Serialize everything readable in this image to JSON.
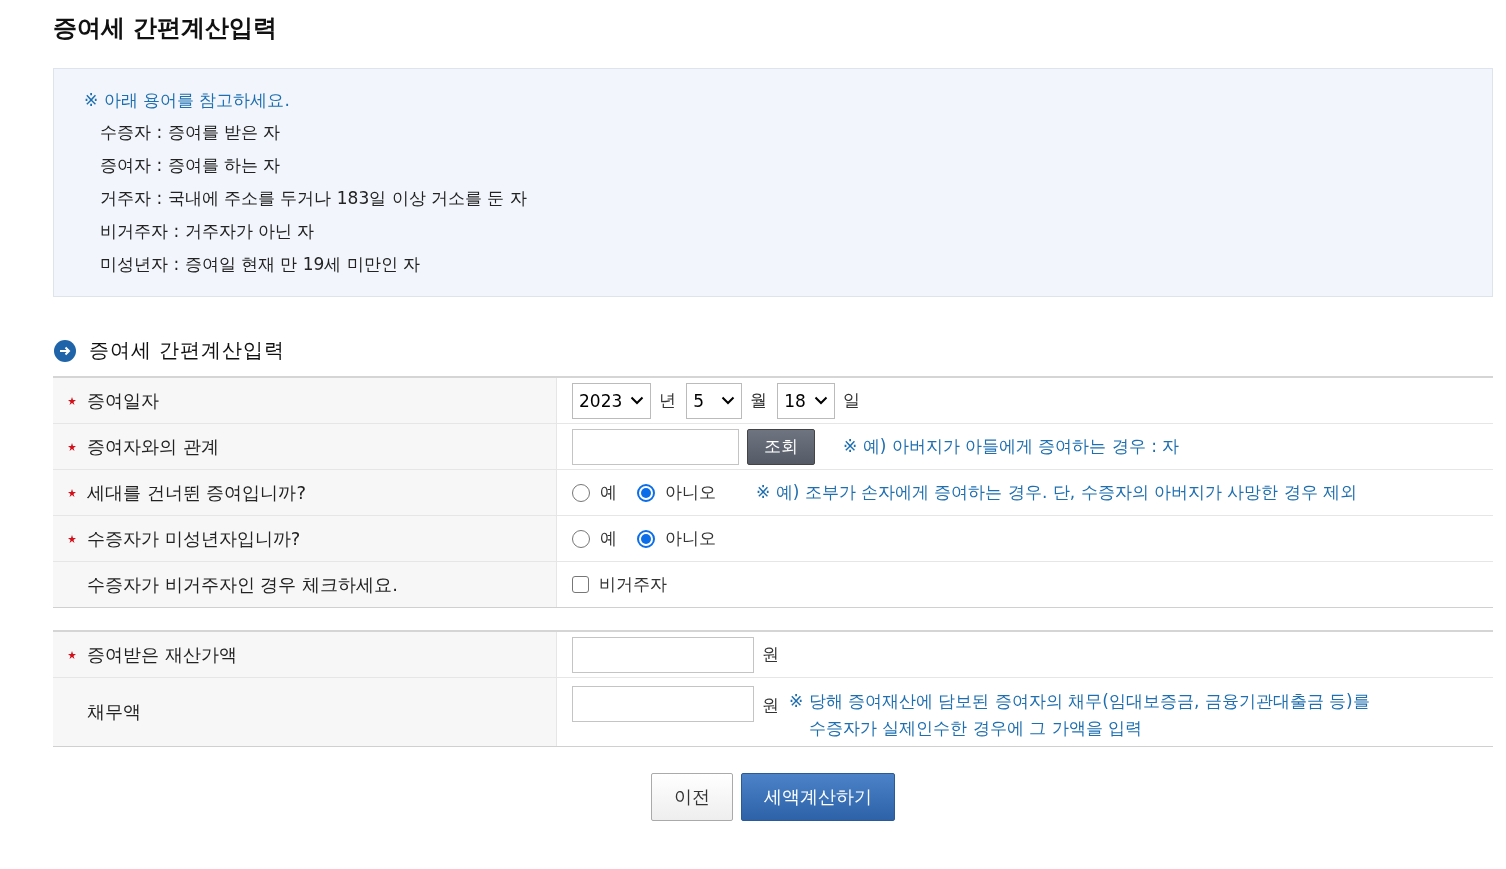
{
  "page_title": "증여세 간편계산입력",
  "terms_box": {
    "heading": "※ 아래 용어를 참고하세요.",
    "items": [
      "수증자 : 증여를 받은 자",
      "증여자 : 증여를 하는 자",
      "거주자 : 국내에 주소를 두거나 183일 이상 거소를 둔 자",
      "비거주자 : 거주자가 아닌 자",
      "미성년자 : 증여일 현재 만 19세 미만인 자"
    ]
  },
  "section_title": "증여세 간편계산입력",
  "form_groups": [
    {
      "rows": [
        {
          "kind": "date",
          "label": "증여일자",
          "required": true,
          "fields": [
            {
              "value": "2023",
              "unit": "년"
            },
            {
              "value": "5",
              "unit": "월"
            },
            {
              "value": "18",
              "unit": "일"
            }
          ]
        },
        {
          "kind": "lookup",
          "label": "증여자와의 관계",
          "required": true,
          "button": "조회",
          "note": "※ 예) 아버지가 아들에게 증여하는 경우 : 자"
        },
        {
          "kind": "radio",
          "label": "세대를 건너뛴 증여입니까?",
          "required": true,
          "options": [
            {
              "label": "예",
              "selected": false
            },
            {
              "label": "아니오",
              "selected": true
            }
          ],
          "note": "※ 예) 조부가 손자에게 증여하는 경우. 단, 수증자의 아버지가 사망한 경우 제외"
        },
        {
          "kind": "radio",
          "label": "수증자가 미성년자입니까?",
          "required": true,
          "options": [
            {
              "label": "예",
              "selected": false
            },
            {
              "label": "아니오",
              "selected": true
            }
          ]
        },
        {
          "kind": "checkbox",
          "label": "수증자가 비거주자인 경우 체크하세요.",
          "required": false,
          "option": {
            "label": "비거주자",
            "checked": false
          }
        }
      ]
    },
    {
      "rows": [
        {
          "kind": "amount",
          "label": "증여받은 재산가액",
          "required": true,
          "unit": "원"
        },
        {
          "kind": "amount",
          "label": "채무액",
          "required": false,
          "unit": "원",
          "note_lines": [
            "※ 당해 증여재산에 담보된 증여자의 채무(임대보증금, 금융기관대출금 등)를",
            "수증자가 실제인수한 경우에 그 가액을 입력"
          ]
        }
      ]
    }
  ],
  "buttons": [
    {
      "label": "이전",
      "kind": "secondary"
    },
    {
      "label": "세액계산하기",
      "kind": "primary"
    }
  ]
}
